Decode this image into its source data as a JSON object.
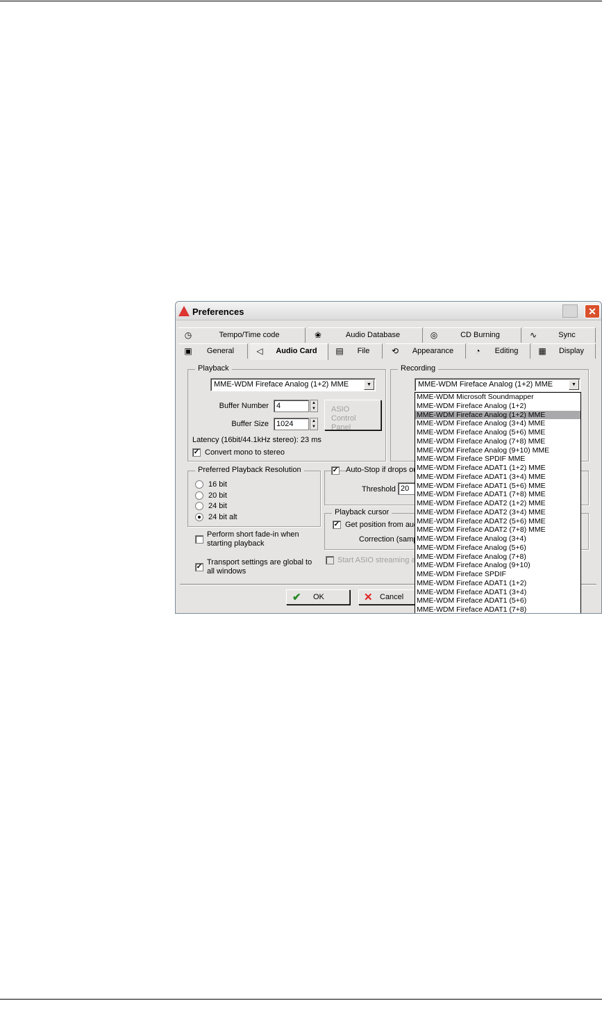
{
  "window": {
    "title": "Preferences",
    "close": "✕"
  },
  "tabs_row1": [
    {
      "label": "Tempo/Time code",
      "icon": "◷"
    },
    {
      "label": "Audio Database",
      "icon": "❀"
    },
    {
      "label": "CD Burning",
      "icon": "◎"
    },
    {
      "label": "Sync",
      "icon": "∿"
    }
  ],
  "tabs_row2": [
    {
      "label": "General",
      "icon": "▣"
    },
    {
      "label": "Audio Card",
      "icon": "◁"
    },
    {
      "label": "File",
      "icon": "▤"
    },
    {
      "label": "Appearance",
      "icon": "⟲"
    },
    {
      "label": "Editing",
      "icon": "◔"
    },
    {
      "label": "Display",
      "icon": "▦"
    }
  ],
  "playback": {
    "label": "Playback",
    "device": "MME-WDM Fireface Analog (1+2) MME",
    "buffer_number_label": "Buffer Number",
    "buffer_number": "4",
    "buffer_size_label": "Buffer Size",
    "buffer_size": "1024",
    "asio_line1": "ASIO",
    "asio_line2": "Control Panel",
    "latency": "Latency (16bit/44.1kHz stereo): 23 ms",
    "convert_mono": "Convert mono to stereo"
  },
  "recording": {
    "label": "Recording",
    "device": "MME-WDM Fireface Analog (1+2) MME",
    "selected_index": 2,
    "options": [
      "MME-WDM Microsoft Soundmapper",
      "MME-WDM Fireface Analog (1+2)",
      "MME-WDM Fireface Analog (1+2) MME",
      "MME-WDM Fireface Analog (3+4) MME",
      "MME-WDM Fireface Analog (5+6) MME",
      "MME-WDM Fireface Analog (7+8) MME",
      "MME-WDM Fireface Analog (9+10) MME",
      "MME-WDM Fireface SPDIF MME",
      "MME-WDM Fireface ADAT1 (1+2) MME",
      "MME-WDM Fireface ADAT1 (3+4) MME",
      "MME-WDM Fireface ADAT1 (5+6) MME",
      "MME-WDM Fireface ADAT1 (7+8) MME",
      "MME-WDM Fireface ADAT2 (1+2) MME",
      "MME-WDM Fireface ADAT2 (3+4) MME",
      "MME-WDM Fireface ADAT2 (5+6) MME",
      "MME-WDM Fireface ADAT2 (7+8) MME",
      "MME-WDM Fireface Analog (3+4)",
      "MME-WDM Fireface Analog (5+6)",
      "MME-WDM Fireface Analog (7+8)",
      "MME-WDM Fireface Analog (9+10)",
      "MME-WDM Fireface SPDIF",
      "MME-WDM Fireface ADAT1 (1+2)",
      "MME-WDM Fireface ADAT1 (3+4)",
      "MME-WDM Fireface ADAT1 (5+6)",
      "MME-WDM Fireface ADAT1 (7+8)"
    ]
  },
  "resolution": {
    "label": "Preferred Playback Resolution",
    "options": [
      "16 bit",
      "20 bit",
      "24 bit",
      "24 bit alt"
    ],
    "selected": "24 bit alt"
  },
  "fade_in": {
    "line1": "Perform short fade-in when",
    "line2": "starting playback"
  },
  "transport": {
    "line1": "Transport settings are global to",
    "line2": "all windows"
  },
  "autostop": {
    "label": "Auto-Stop if drops ou",
    "threshold_label": "Threshold",
    "threshold": "20"
  },
  "cursor": {
    "label": "Playback cursor",
    "get_position": "Get position from audi",
    "correction": "Correction (sampl"
  },
  "asio_streaming": "Start ASIO streaming at",
  "buttons": {
    "ok": "OK",
    "cancel": "Cancel",
    "ok_icon": "✔",
    "cancel_icon": "✕"
  }
}
